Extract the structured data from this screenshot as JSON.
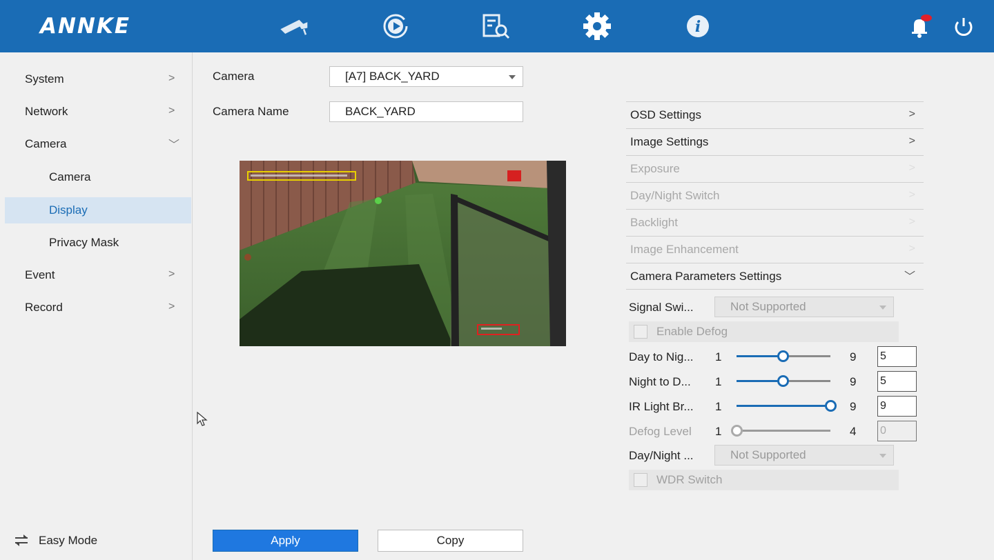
{
  "app": {
    "logo": "ANNKE"
  },
  "topbar": {
    "icons": [
      "camera-icon",
      "playback-icon",
      "search-file-icon",
      "gear-icon",
      "info-icon",
      "bell-icon",
      "power-icon"
    ],
    "active": "gear-icon"
  },
  "sidebar": {
    "items": [
      {
        "label": "System",
        "chevron": ">"
      },
      {
        "label": "Network",
        "chevron": ">"
      },
      {
        "label": "Camera",
        "chevron": "﹀"
      },
      {
        "label": "Camera"
      },
      {
        "label": "Display"
      },
      {
        "label": "Privacy Mask"
      },
      {
        "label": "Event",
        "chevron": ">"
      },
      {
        "label": "Record",
        "chevron": ">"
      }
    ],
    "active": "Display",
    "easy_mode": "Easy Mode"
  },
  "form": {
    "camera_label": "Camera",
    "camera_value": "[A7] BACK_YARD",
    "camera_name_label": "Camera Name",
    "camera_name_value": "BACK_YARD"
  },
  "settings": {
    "sections": [
      {
        "label": "OSD Settings",
        "chevron": ">",
        "enabled": true
      },
      {
        "label": "Image Settings",
        "chevron": ">",
        "enabled": true
      },
      {
        "label": "Exposure",
        "chevron": ">",
        "enabled": false
      },
      {
        "label": "Day/Night Switch",
        "chevron": ">",
        "enabled": false
      },
      {
        "label": "Backlight",
        "chevron": ">",
        "enabled": false
      },
      {
        "label": "Image Enhancement",
        "chevron": ">",
        "enabled": false
      },
      {
        "label": "Camera Parameters Settings",
        "chevron": "﹀",
        "enabled": true
      }
    ],
    "params": {
      "signal_switch_label": "Signal Swi...",
      "signal_switch_value": "Not Supported",
      "enable_defog_label": "Enable Defog",
      "day_to_night": {
        "label": "Day to Nig...",
        "min": "1",
        "max": "9",
        "value": "5"
      },
      "night_to_day": {
        "label": "Night to D...",
        "min": "1",
        "max": "9",
        "value": "5"
      },
      "ir_light": {
        "label": "IR Light Br...",
        "min": "1",
        "max": "9",
        "value": "9"
      },
      "defog_level": {
        "label": "Defog Level",
        "min": "1",
        "max": "4",
        "value": "0"
      },
      "day_night_label": "Day/Night ...",
      "day_night_value": "Not Supported",
      "wdr_label": "WDR Switch"
    }
  },
  "buttons": {
    "apply": "Apply",
    "copy": "Copy"
  },
  "colors": {
    "topbar": "#1a6cb5",
    "accent": "#1f78e0",
    "active_nav_bg": "#d6e4f2"
  }
}
